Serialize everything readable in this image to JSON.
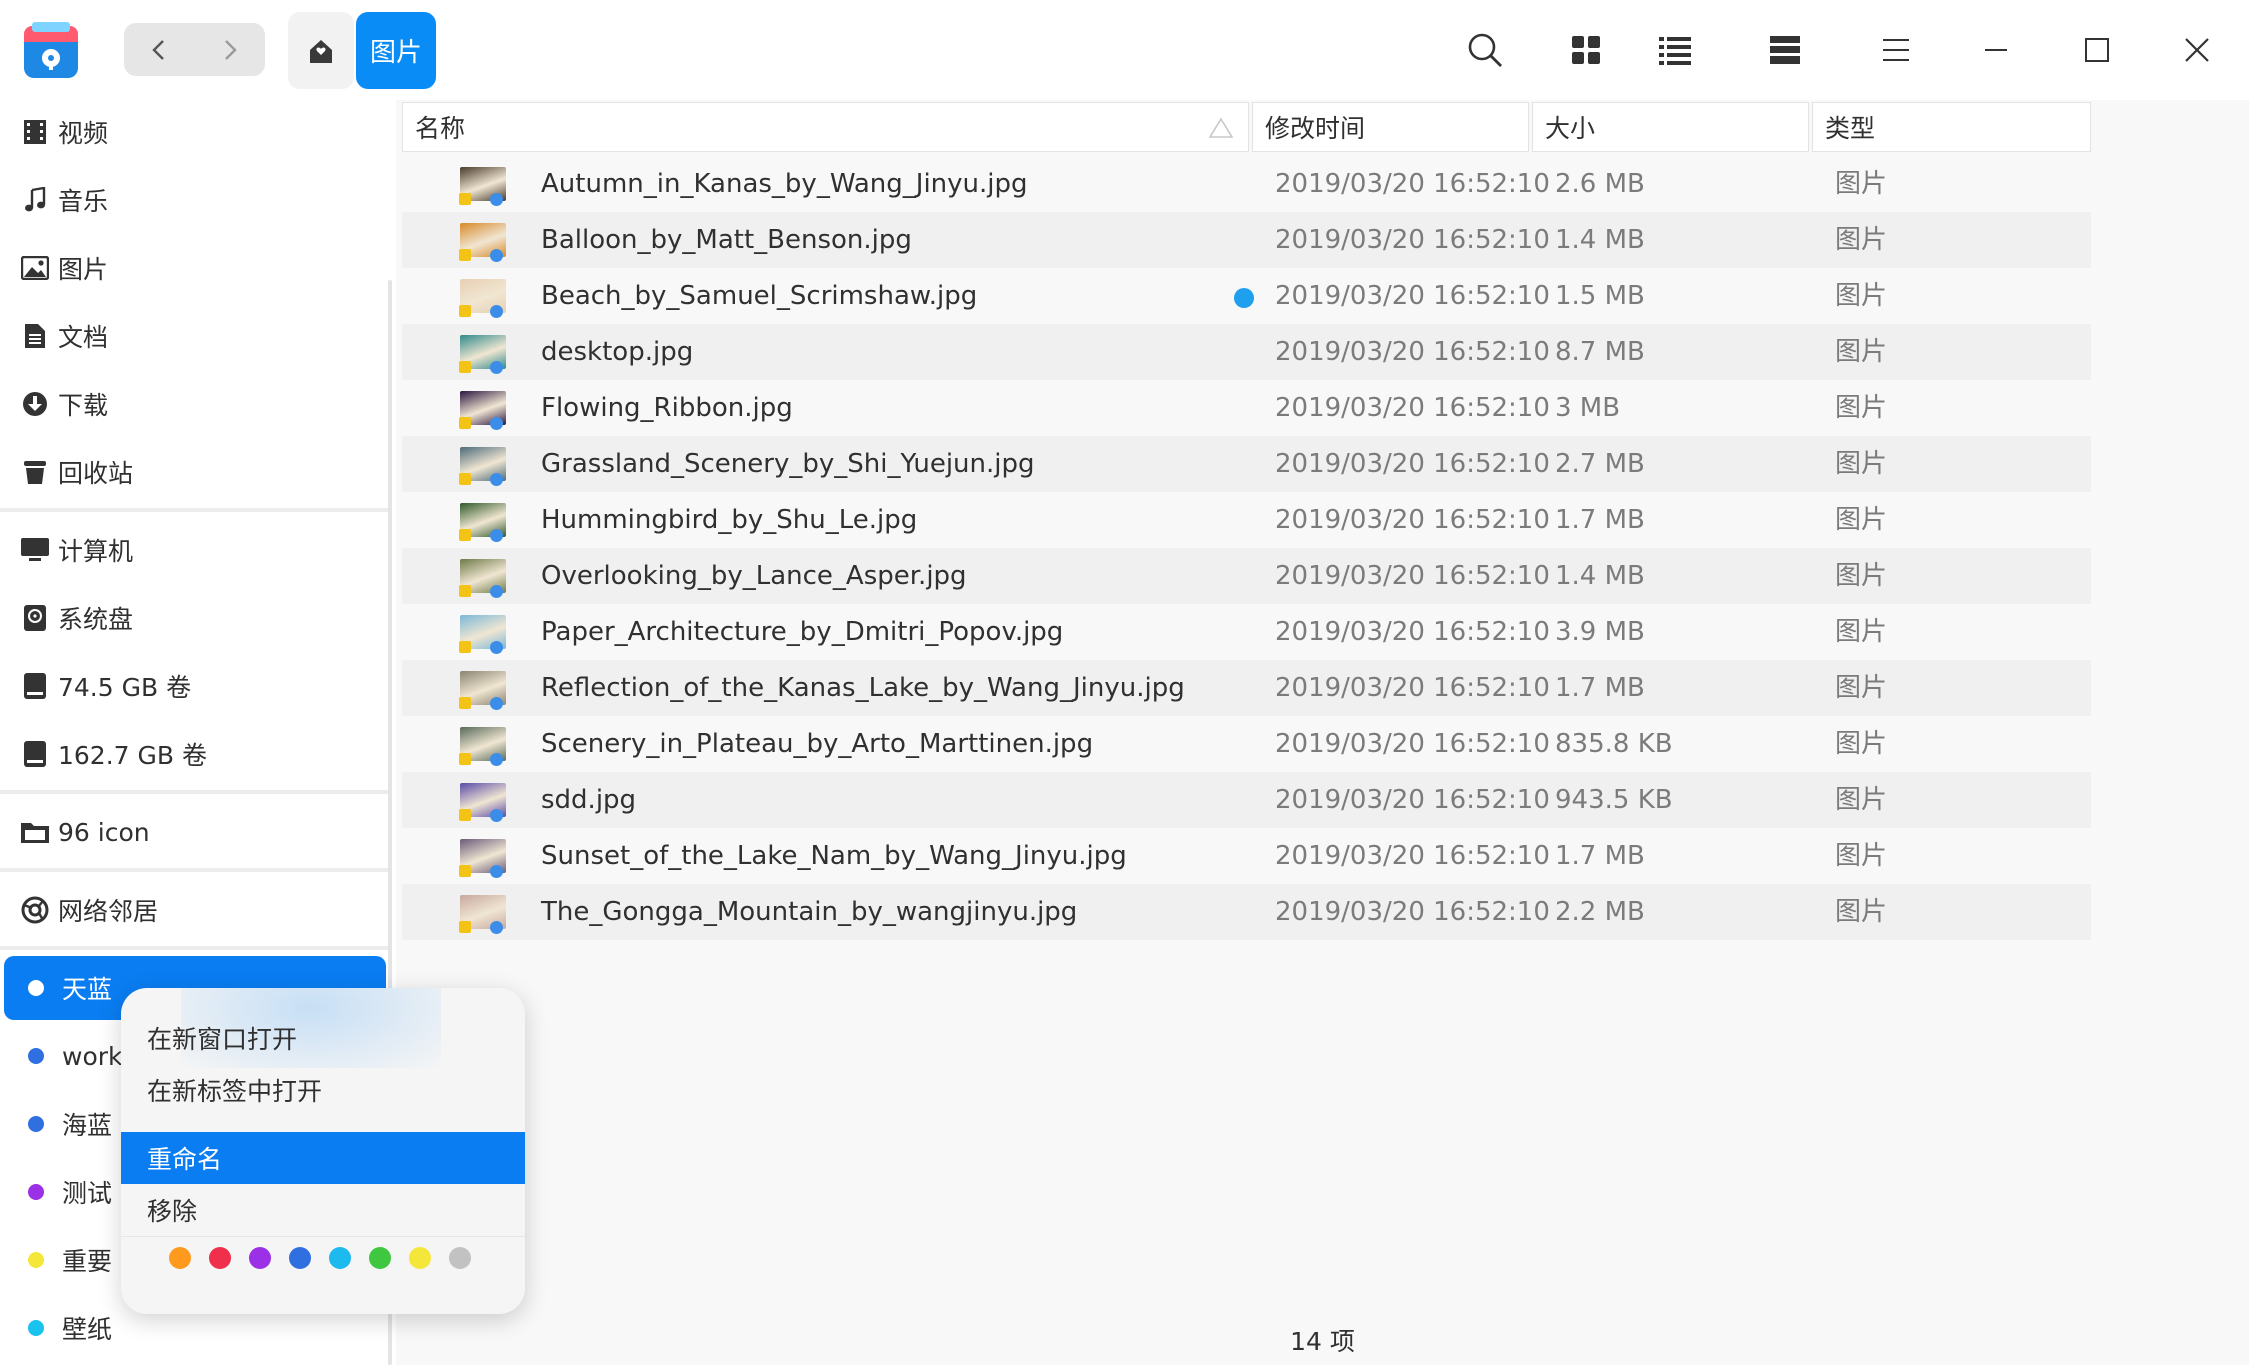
{
  "breadcrumb": {
    "current": "图片"
  },
  "titlebar": {
    "icons": [
      "search-icon",
      "icon-view-icon",
      "list-view-icon",
      "detail-view-icon",
      "menu-icon",
      "minimize-icon",
      "maximize-icon",
      "close-icon"
    ]
  },
  "sidebar": {
    "items": [
      {
        "label": "视频",
        "icon": "video-icon"
      },
      {
        "label": "音乐",
        "icon": "music-icon"
      },
      {
        "label": "图片",
        "icon": "picture-icon"
      },
      {
        "label": "文档",
        "icon": "document-icon"
      },
      {
        "label": "下载",
        "icon": "download-icon"
      },
      {
        "label": "回收站",
        "icon": "trash-icon"
      }
    ],
    "devices": [
      {
        "label": "计算机",
        "icon": "computer-icon"
      },
      {
        "label": "系统盘",
        "icon": "system-disk-icon"
      },
      {
        "label": "74.5 GB 卷",
        "icon": "disk-icon"
      },
      {
        "label": "162.7 GB 卷",
        "icon": "disk-icon"
      }
    ],
    "bookmark": {
      "label": "96 icon",
      "icon": "folder-icon"
    },
    "network": {
      "label": "网络邻居",
      "icon": "network-icon"
    },
    "tags": [
      {
        "label": "天蓝",
        "color": "#ffffff"
      },
      {
        "label": "work",
        "color": "#2f6fe0"
      },
      {
        "label": "海蓝",
        "color": "#2f6fe0"
      },
      {
        "label": "测试",
        "color": "#9b30e6"
      },
      {
        "label": "重要",
        "color": "#f5e63a"
      },
      {
        "label": "壁纸",
        "color": "#1cc2ee"
      }
    ]
  },
  "columns": {
    "name": "名称",
    "modified": "修改时间",
    "size": "大小",
    "type": "类型"
  },
  "files": [
    {
      "name": "Autumn_in_Kanas_by_Wang_Jinyu.jpg",
      "modified": "2019/03/20 16:52:10",
      "size": "2.6 MB",
      "type": "图片",
      "thumb": "#4a3a2c"
    },
    {
      "name": "Balloon_by_Matt_Benson.jpg",
      "modified": "2019/03/20 16:52:10",
      "size": "1.4 MB",
      "type": "图片",
      "thumb": "#d8892a"
    },
    {
      "name": "Beach_by_Samuel_Scrimshaw.jpg",
      "modified": "2019/03/20 16:52:10",
      "size": "1.5 MB",
      "type": "图片",
      "thumb": "#e8cfb2",
      "tag": "#1ea0ef"
    },
    {
      "name": "desktop.jpg",
      "modified": "2019/03/20 16:52:10",
      "size": "8.7 MB",
      "type": "图片",
      "thumb": "#2e8a8a"
    },
    {
      "name": "Flowing_Ribbon.jpg",
      "modified": "2019/03/20 16:52:10",
      "size": "3 MB",
      "type": "图片",
      "thumb": "#2a1640"
    },
    {
      "name": "Grassland_Scenery_by_Shi_Yuejun.jpg",
      "modified": "2019/03/20 16:52:10",
      "size": "2.7 MB",
      "type": "图片",
      "thumb": "#4c6a7a"
    },
    {
      "name": "Hummingbird_by_Shu_Le.jpg",
      "modified": "2019/03/20 16:52:10",
      "size": "1.7 MB",
      "type": "图片",
      "thumb": "#2f5a2a"
    },
    {
      "name": "Overlooking_by_Lance_Asper.jpg",
      "modified": "2019/03/20 16:52:10",
      "size": "1.4 MB",
      "type": "图片",
      "thumb": "#6e7a4a"
    },
    {
      "name": "Paper_Architecture_by_Dmitri_Popov.jpg",
      "modified": "2019/03/20 16:52:10",
      "size": "3.9 MB",
      "type": "图片",
      "thumb": "#7ab8d8"
    },
    {
      "name": "Reflection_of_the_Kanas_Lake_by_Wang_Jinyu.jpg",
      "modified": "2019/03/20 16:52:10",
      "size": "1.7 MB",
      "type": "图片",
      "thumb": "#8a8470"
    },
    {
      "name": "Scenery_in_Plateau_by_Arto_Marttinen.jpg",
      "modified": "2019/03/20 16:52:10",
      "size": "835.8 KB",
      "type": "图片",
      "thumb": "#5a6a5a"
    },
    {
      "name": "sdd.jpg",
      "modified": "2019/03/20 16:52:10",
      "size": "943.5 KB",
      "type": "图片",
      "thumb": "#5a4aa8"
    },
    {
      "name": "Sunset_of_the_Lake_Nam_by_Wang_Jinyu.jpg",
      "modified": "2019/03/20 16:52:10",
      "size": "1.7 MB",
      "type": "图片",
      "thumb": "#6a5a7a"
    },
    {
      "name": "The_Gongga_Mountain_by_wangjinyu.jpg",
      "modified": "2019/03/20 16:52:10",
      "size": "2.2 MB",
      "type": "图片",
      "thumb": "#c8a8a0"
    }
  ],
  "status": {
    "count": "14 项"
  },
  "context_menu": {
    "items": [
      "在新窗口打开",
      "在新标签中打开",
      "重命名",
      "移除"
    ],
    "highlighted": "重命名",
    "colors": [
      "#ff9a1f",
      "#ef2f4b",
      "#9b30e6",
      "#2f6fe0",
      "#1cbaee",
      "#3fc73f",
      "#f5e63a",
      "#c2c2c2"
    ]
  }
}
